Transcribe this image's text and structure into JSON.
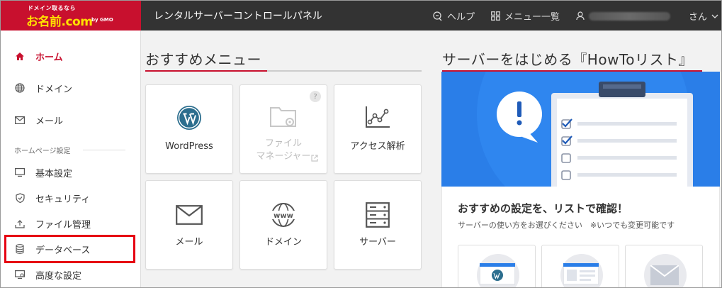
{
  "logo": {
    "tagline": "ドメイン取るなら",
    "brand": "お名前.com",
    "by": "by GMO"
  },
  "header": {
    "title": "レンタルサーバーコントロールパネル",
    "help": "ヘルプ",
    "menu_list": "メニュー一覧",
    "user_suffix": "さん"
  },
  "sidebar": {
    "items": [
      {
        "label": "ホーム",
        "icon": "home-icon"
      },
      {
        "label": "ドメイン",
        "icon": "globe-icon"
      },
      {
        "label": "メール",
        "icon": "mail-icon"
      },
      {
        "label": "基本設定",
        "icon": "monitor-icon"
      },
      {
        "label": "セキュリティ",
        "icon": "shield-icon"
      },
      {
        "label": "ファイル管理",
        "icon": "upload-icon"
      },
      {
        "label": "データベース",
        "icon": "database-icon"
      },
      {
        "label": "高度な設定",
        "icon": "advanced-settings-icon"
      }
    ],
    "section_label": "ホームページ設定"
  },
  "recommend": {
    "title": "おすすめメニュー",
    "cards": [
      {
        "label": "WordPress",
        "icon": "wordpress-icon"
      },
      {
        "label": "ファイル\nマネージャー",
        "icon": "folder-settings-icon",
        "disabled": true,
        "badge": "?"
      },
      {
        "label": "アクセス解析",
        "icon": "analytics-icon"
      },
      {
        "label": "メール",
        "icon": "mail-icon"
      },
      {
        "label": "ドメイン",
        "icon": "www-globe-icon"
      },
      {
        "label": "サーバー",
        "icon": "server-icon"
      }
    ]
  },
  "howto": {
    "title": "サーバーをはじめる『HowToリスト』",
    "heading": "おすすめの設定を、リストで確認！",
    "subtext": "サーバーの使い方をお選びください　※いつでも変更可能です"
  },
  "colors": {
    "brand_red": "#c8102e",
    "topbar": "#333333",
    "hero_blue": "#2a7ee8",
    "logo_yellow": "#ffe000"
  }
}
